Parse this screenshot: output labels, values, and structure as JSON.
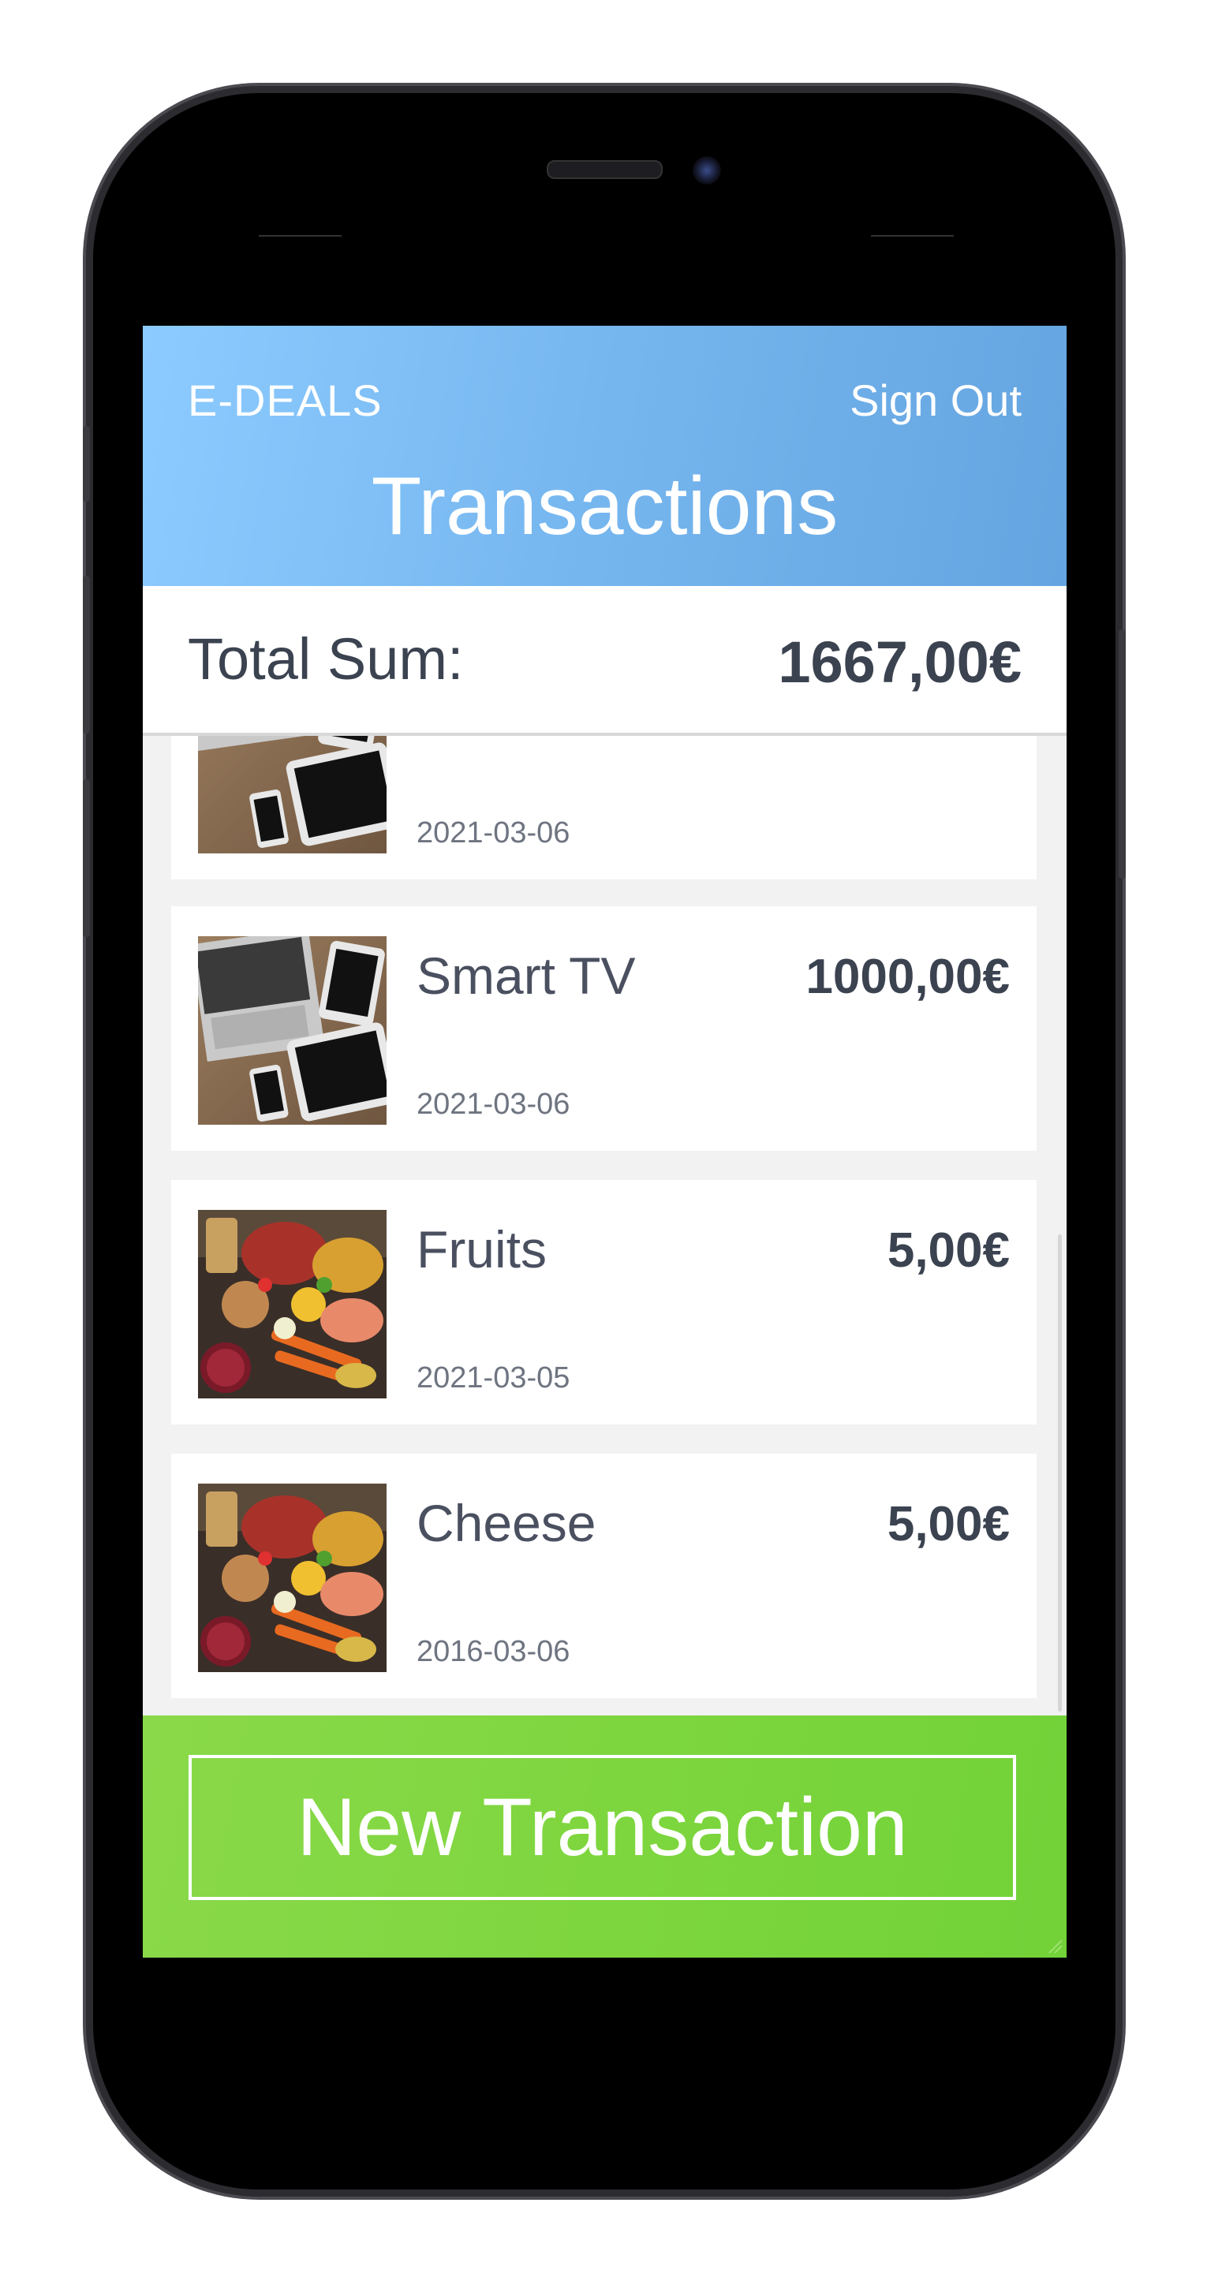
{
  "app": {
    "brand": "E-DEALS",
    "sign_out_label": "Sign Out",
    "page_title": "Transactions"
  },
  "summary": {
    "label": "Total Sum:",
    "value": "1667,00€"
  },
  "transactions": [
    {
      "name": "",
      "price": "",
      "date": "2021-03-06",
      "image": "electronics-photo"
    },
    {
      "name": "Smart TV",
      "price": "1000,00€",
      "date": "2021-03-06",
      "image": "electronics-photo"
    },
    {
      "name": "Fruits",
      "price": "5,00€",
      "date": "2021-03-05",
      "image": "food-photo"
    },
    {
      "name": "Cheese",
      "price": "5,00€",
      "date": "2016-03-06",
      "image": "food-photo"
    }
  ],
  "footer": {
    "new_transaction_label": "New Transaction"
  },
  "colors": {
    "header_gradient_start": "#8ccbff",
    "header_gradient_end": "#64a4e0",
    "footer_green": "#7ed63e",
    "text_dark": "#3b4250"
  }
}
